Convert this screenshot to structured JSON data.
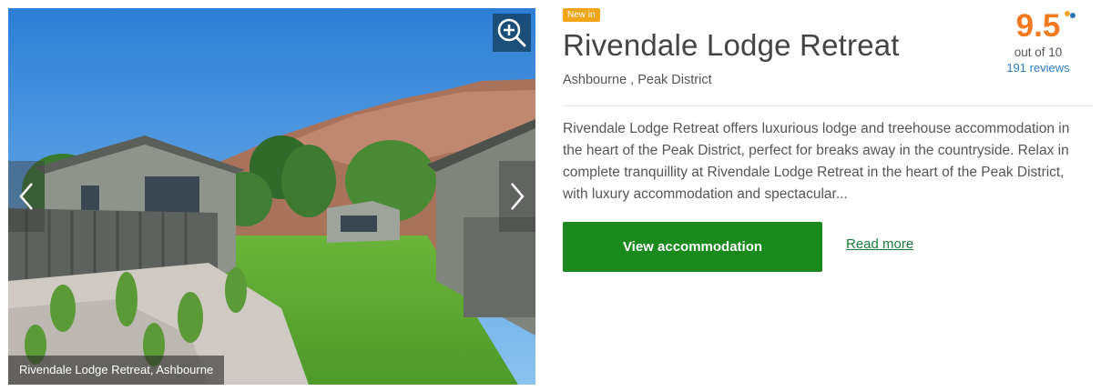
{
  "gallery": {
    "caption": "Rivendale Lodge Retreat, Ashbourne",
    "zoom_icon": "zoom-in-icon",
    "prev_icon": "chevron-left-icon",
    "next_icon": "chevron-right-icon"
  },
  "listing": {
    "badge": "New in",
    "title": "Rivendale Lodge Retreat",
    "location": "Ashbourne , Peak District",
    "description": "Rivendale Lodge Retreat offers luxurious lodge and treehouse accommodation in the heart of the Peak District, perfect for breaks away in the countryside. Relax in complete tranquillity at Rivendale Lodge Retreat in the heart of the Peak District, with luxury accommodation and spectacular...",
    "cta_label": "View accommodation",
    "read_more": "Read more"
  },
  "rating": {
    "score": "9.5",
    "out_of": "out of 10",
    "reviews": "191 reviews"
  },
  "colors": {
    "badge": "#f3a51a",
    "score": "#f47a20",
    "cta": "#1a8a1e",
    "link": "#2a7abf",
    "read_more": "#1a7a3a"
  }
}
